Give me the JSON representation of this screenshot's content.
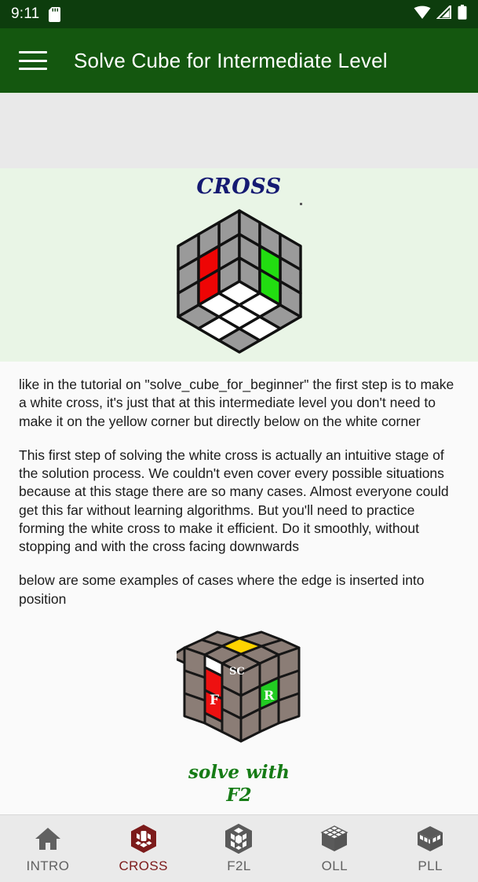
{
  "status_bar": {
    "time": "9:11",
    "icons": [
      "sd-card-icon",
      "wifi-icon",
      "cellular-signal-icon",
      "battery-icon"
    ]
  },
  "app_bar": {
    "menu_icon": "hamburger-menu-icon",
    "title": "Solve Cube for Intermediate Level",
    "background_color": "#14570f"
  },
  "ad_band": {
    "label": "",
    "background_color": "#e9e9e9"
  },
  "hero": {
    "title": "CROSS",
    "title_color": "#151a72",
    "background_color": "#e9f5e6",
    "image_alt": "rubiks-cube-white-cross-bottom"
  },
  "body": {
    "paragraphs": [
      "like in the tutorial on \"solve_cube_for_beginner\" the first step is to make a white cross, it's just that at this intermediate level you don't need to make it on the yellow corner but directly below on the white corner",
      " This first step of solving the white cross is actually an intuitive stage of the solution process. We couldn't even cover every possible situations because at this stage there are so many cases. Almost everyone could get this far without learning algorithms. But you'll need to practice forming the white cross to make it efficient. Do it smoothly, without stopping and with the cross facing downwards",
      "below are some examples of cases where the edge is inserted into position"
    ],
    "text_color": "#1b1b1b"
  },
  "figure2": {
    "image_alt": "rubiks-cube-edge-insert-example",
    "face_labels": {
      "front": "F",
      "right": "R",
      "sticker": "SC"
    },
    "caption_line1": "solve with",
    "caption_line2": "F2",
    "caption_color": "#167c16"
  },
  "bottom_nav": {
    "active_index": 1,
    "active_color": "#7c1b1b",
    "inactive_color": "#616161",
    "items": [
      {
        "label": "INTRO",
        "icon": "home-icon"
      },
      {
        "label": "CROSS",
        "icon": "cross-cube-icon"
      },
      {
        "label": "F2L",
        "icon": "f2l-cube-icon"
      },
      {
        "label": "OLL",
        "icon": "oll-cube-icon"
      },
      {
        "label": "PLL",
        "icon": "pll-cube-icon"
      }
    ]
  }
}
